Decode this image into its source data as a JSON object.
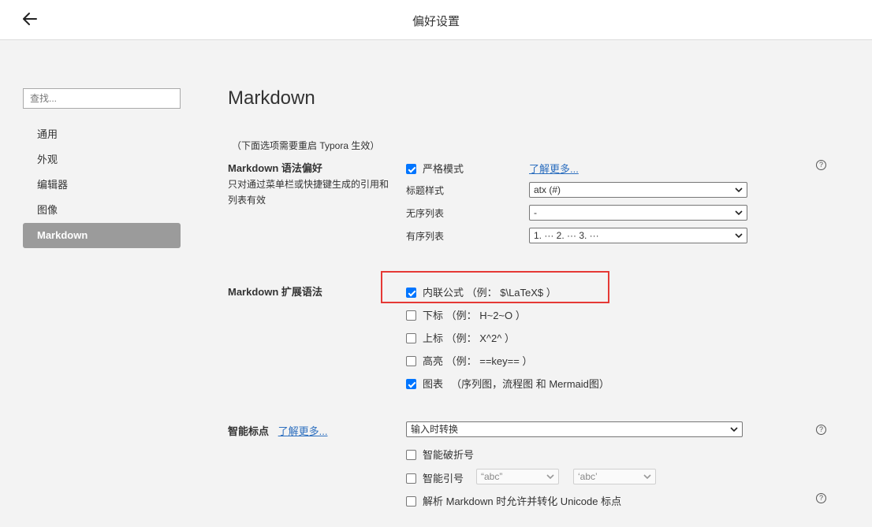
{
  "window": {
    "title": "偏好设置"
  },
  "sidebar": {
    "search_placeholder": "查找...",
    "items": [
      {
        "label": "通用"
      },
      {
        "label": "外观"
      },
      {
        "label": "编辑器"
      },
      {
        "label": "图像"
      },
      {
        "label": "Markdown",
        "active": true
      }
    ]
  },
  "main": {
    "heading": "Markdown",
    "restart_note": "（下面选项需要重启 Typora 生效）",
    "syntax_pref": {
      "title": "Markdown 语法偏好",
      "desc": "只对通过菜单栏或快捷键生成的引用和列表有效",
      "strict_label": "严格模式",
      "strict_checked": true,
      "learn_more": "了解更多...",
      "heading_style_label": "标题样式",
      "heading_style_value": "atx (#)",
      "unordered_label": "无序列表",
      "unordered_value": "-",
      "ordered_label": "有序列表",
      "ordered_value": "1. ··· 2. ··· 3. ···"
    },
    "extensions": {
      "title": "Markdown 扩展语法",
      "items": [
        {
          "label": "内联公式 （例： $\\LaTeX$ ）",
          "checked": true,
          "highlighted": true
        },
        {
          "label": "下标 （例： H~2~O ）",
          "checked": false
        },
        {
          "label": "上标 （例： X^2^ ）",
          "checked": false
        },
        {
          "label": "高亮 （例： ==key== ）",
          "checked": false
        },
        {
          "label": "图表 　（序列图，流程图 和 Mermaid图）",
          "checked": true
        }
      ]
    },
    "smart_punct": {
      "title": "智能标点",
      "learn_more": "了解更多...",
      "mode_value": "输入时转换",
      "smart_dash_label": "智能破折号",
      "smart_dash_checked": false,
      "smart_quote_label": "智能引号",
      "smart_quote_checked": false,
      "double_quote_value": "“abc”",
      "single_quote_value": "‘abc’",
      "unicode_label": "解析 Markdown 时允许并转化 Unicode 标点",
      "unicode_checked": false
    }
  },
  "icons": {
    "back": "arrow-left-icon",
    "help": "question-circle-icon",
    "dropdown": "chevron-down-icon"
  },
  "colors": {
    "accent": "#0075ff",
    "highlight_border": "#e53935",
    "link": "#2d6fbf",
    "active_nav": "#9b9b9b"
  }
}
